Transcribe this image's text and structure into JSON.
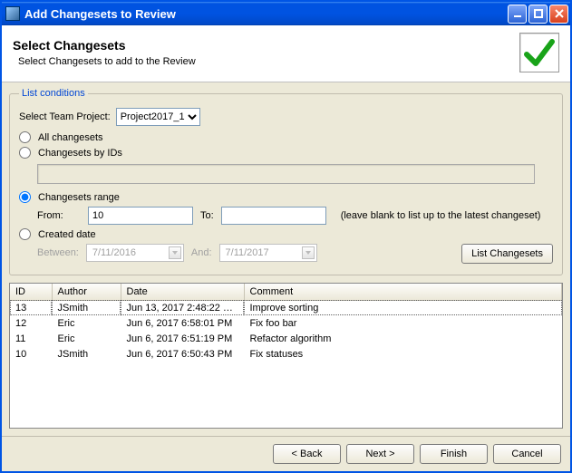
{
  "window": {
    "title": "Add Changesets to Review"
  },
  "banner": {
    "heading": "Select Changesets",
    "sub": "Select Changesets to add to the Review"
  },
  "conditions": {
    "legend": "List conditions",
    "project_label": "Select Team Project:",
    "project_value": "Project2017_1",
    "opt_all": "All changesets",
    "opt_ids": "Changesets by IDs",
    "ids_value": "",
    "opt_range": "Changesets range",
    "range_from_label": "From:",
    "range_from_value": "10",
    "range_to_label": "To:",
    "range_to_value": "",
    "range_hint": "(leave blank to list up to the latest changeset)",
    "opt_created": "Created date",
    "between_label": "Between:",
    "between_value": "7/11/2016",
    "and_label": "And:",
    "and_value": "7/11/2017",
    "list_btn": "List Changesets"
  },
  "table": {
    "headers": {
      "id": "ID",
      "author": "Author",
      "date": "Date",
      "comment": "Comment"
    },
    "rows": [
      {
        "id": "13",
        "author": "JSmith",
        "date": "Jun 13, 2017 2:48:22 …",
        "comment": "Improve sorting"
      },
      {
        "id": "12",
        "author": "Eric",
        "date": "Jun 6, 2017 6:58:01 PM",
        "comment": "Fix foo bar"
      },
      {
        "id": "11",
        "author": "Eric",
        "date": "Jun 6, 2017 6:51:19 PM",
        "comment": "Refactor algorithm"
      },
      {
        "id": "10",
        "author": "JSmith",
        "date": "Jun 6, 2017 6:50:43 PM",
        "comment": "Fix statuses"
      }
    ]
  },
  "footer": {
    "back": "< Back",
    "next": "Next >",
    "finish": "Finish",
    "cancel": "Cancel"
  }
}
